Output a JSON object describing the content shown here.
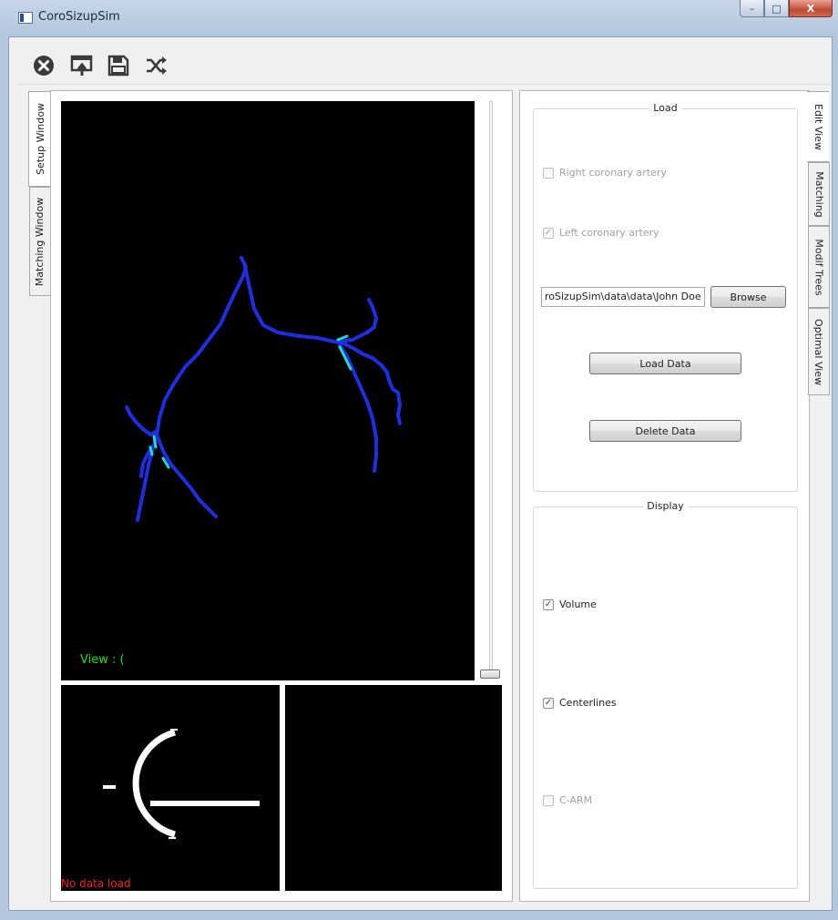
{
  "window": {
    "title": "CoroSizupSim",
    "controls": {
      "minimize": "–",
      "maximize": "□",
      "close": "X"
    }
  },
  "toolbar": {
    "buttons": [
      {
        "name": "close-data",
        "icon": "close-circle-icon"
      },
      {
        "name": "export-view",
        "icon": "export-icon"
      },
      {
        "name": "save",
        "icon": "save-icon"
      },
      {
        "name": "shuffle",
        "icon": "shuffle-icon"
      }
    ]
  },
  "left_tabs": [
    {
      "label": "Setup Window",
      "active": true
    },
    {
      "label": "Matching Window",
      "active": false
    }
  ],
  "viewer": {
    "view_label": "View :  (",
    "status": "No data load"
  },
  "right_tabs": [
    {
      "label": "Edit View",
      "active": true
    },
    {
      "label": "Matching",
      "active": false
    },
    {
      "label": "Modif Trees",
      "active": false
    },
    {
      "label": "Optimal View",
      "active": false
    }
  ],
  "load_group": {
    "title": "Load",
    "right_coronary": {
      "label": "Right coronary artery",
      "checked": false,
      "enabled": false
    },
    "left_coronary": {
      "label": "Left coronary artery",
      "checked": true,
      "enabled": false
    },
    "path_value": "roSizupSim\\data\\data\\John Doe",
    "browse_label": "Browse",
    "load_label": "Load Data",
    "delete_label": "Delete Data"
  },
  "display_group": {
    "title": "Display",
    "volume": {
      "label": "Volume",
      "checked": true
    },
    "centerlines": {
      "label": "Centerlines",
      "checked": true
    },
    "carm": {
      "label": "C-ARM",
      "checked": false,
      "enabled": false
    }
  },
  "colors": {
    "vessel": "#1f2fe0",
    "vessel_highlight": "#2ad6c8",
    "view_text": "#22dd22",
    "status_text": "#e52a2a"
  }
}
